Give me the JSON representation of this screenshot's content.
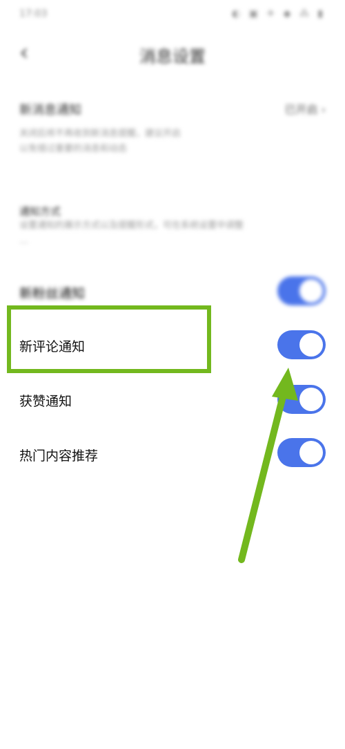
{
  "status_bar": {
    "time": "17:03",
    "icons": "◐ ▣ ✈ ◆ ⁂ ▮"
  },
  "nav": {
    "back_glyph": "‹",
    "title": "消息设置"
  },
  "blurred": {
    "row1_title": "新消息通知",
    "row1_right": "已开启 ›",
    "row1_desc_line1": "关闭后将不再收到新消息提醒，建议开启",
    "row1_desc_line2": "以免错过重要的消息和动态",
    "row2_title": "通知方式",
    "row2_desc_line1": "设置通知的展示方式以及提醒形式，可在系统设置中调整",
    "row2_desc_line2": "…",
    "row3_label": "新粉丝通知"
  },
  "settings": [
    {
      "label": "新评论通知",
      "enabled": true
    },
    {
      "label": "获赞通知",
      "enabled": true
    },
    {
      "label": "热门内容推荐",
      "enabled": true
    }
  ],
  "colors": {
    "toggle_on": "#4a74ea",
    "highlight": "#73b81e"
  }
}
